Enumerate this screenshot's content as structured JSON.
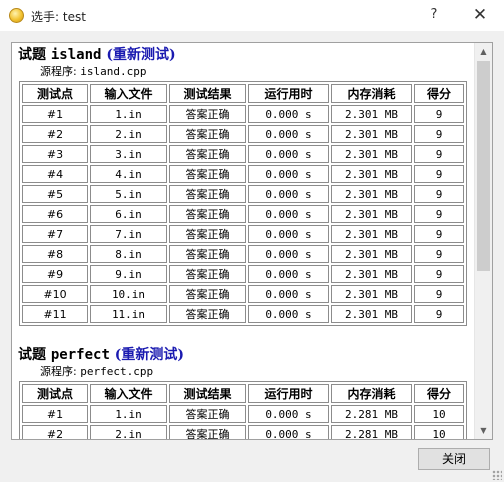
{
  "window": {
    "title": "选手: test",
    "help_label": "?",
    "close_label": "✕"
  },
  "problems": [
    {
      "prefix": "试题",
      "name": "island",
      "retest_label": "(重新测试)",
      "source_label": "源程序:",
      "source_file": "island.cpp",
      "headers": [
        "测试点",
        "输入文件",
        "测试结果",
        "运行用时",
        "内存消耗",
        "得分"
      ],
      "rows": [
        [
          "#1",
          "1.in",
          "答案正确",
          "0.000 s",
          "2.301 MB",
          "9"
        ],
        [
          "#2",
          "2.in",
          "答案正确",
          "0.000 s",
          "2.301 MB",
          "9"
        ],
        [
          "#3",
          "3.in",
          "答案正确",
          "0.000 s",
          "2.301 MB",
          "9"
        ],
        [
          "#4",
          "4.in",
          "答案正确",
          "0.000 s",
          "2.301 MB",
          "9"
        ],
        [
          "#5",
          "5.in",
          "答案正确",
          "0.000 s",
          "2.301 MB",
          "9"
        ],
        [
          "#6",
          "6.in",
          "答案正确",
          "0.000 s",
          "2.301 MB",
          "9"
        ],
        [
          "#7",
          "7.in",
          "答案正确",
          "0.000 s",
          "2.301 MB",
          "9"
        ],
        [
          "#8",
          "8.in",
          "答案正确",
          "0.000 s",
          "2.301 MB",
          "9"
        ],
        [
          "#9",
          "9.in",
          "答案正确",
          "0.000 s",
          "2.301 MB",
          "9"
        ],
        [
          "#10",
          "10.in",
          "答案正确",
          "0.000 s",
          "2.301 MB",
          "9"
        ],
        [
          "#11",
          "11.in",
          "答案正确",
          "0.000 s",
          "2.301 MB",
          "9"
        ]
      ]
    },
    {
      "prefix": "试题",
      "name": "perfect",
      "retest_label": "(重新测试)",
      "source_label": "源程序:",
      "source_file": "perfect.cpp",
      "headers": [
        "测试点",
        "输入文件",
        "测试结果",
        "运行用时",
        "内存消耗",
        "得分"
      ],
      "rows": [
        [
          "#1",
          "1.in",
          "答案正确",
          "0.000 s",
          "2.281 MB",
          "10"
        ],
        [
          "#2",
          "2.in",
          "答案正确",
          "0.000 s",
          "2.281 MB",
          "10"
        ]
      ]
    }
  ],
  "footer": {
    "close_button_label": "关闭"
  },
  "colors": {
    "retest_link": "#1a1ab0",
    "app_icon": "#f2c230"
  },
  "icons": {
    "app": "coin-icon",
    "scroll_up": "chevron-up-icon",
    "scroll_down": "chevron-down-icon"
  }
}
